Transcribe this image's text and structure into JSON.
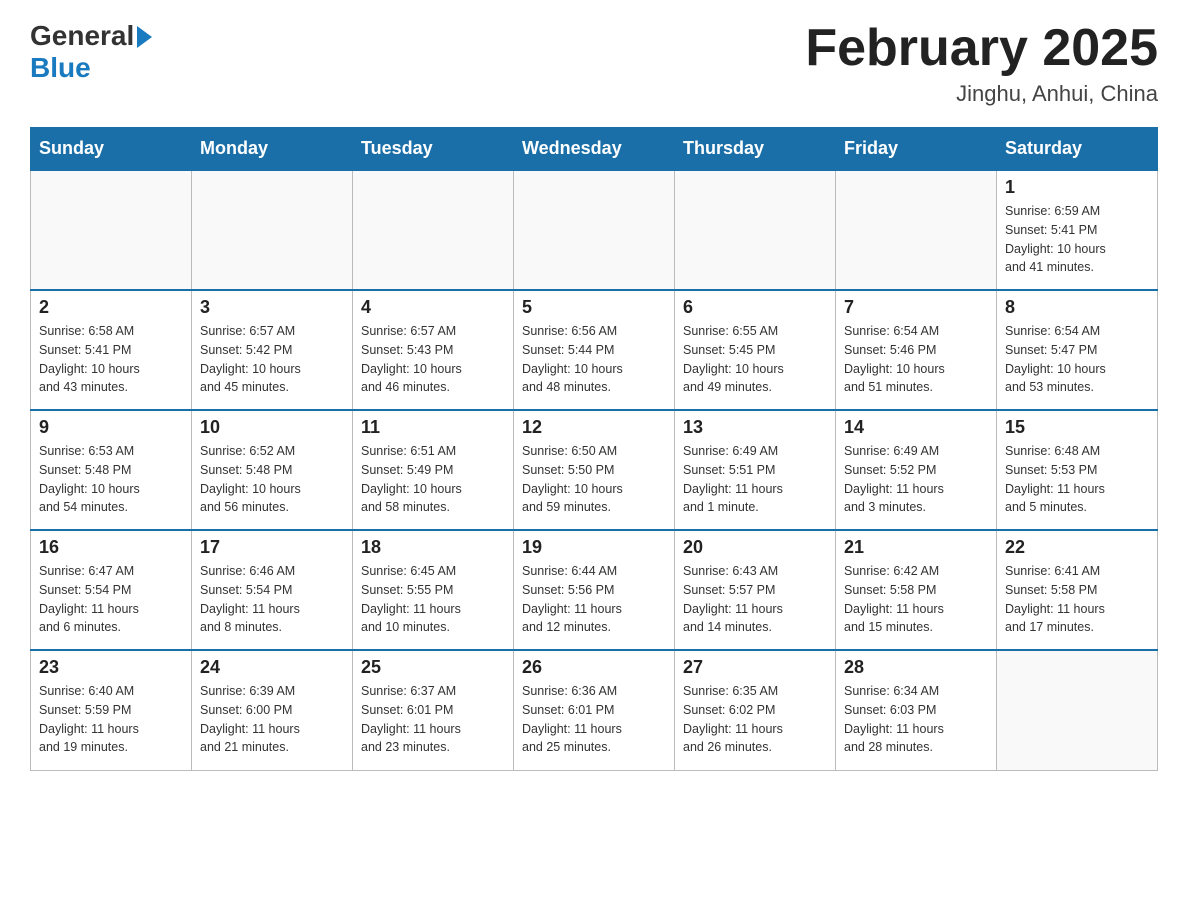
{
  "header": {
    "logo": {
      "general": "General",
      "blue": "Blue",
      "arrow": "▶"
    },
    "title": "February 2025",
    "location": "Jinghu, Anhui, China"
  },
  "weekdays": [
    "Sunday",
    "Monday",
    "Tuesday",
    "Wednesday",
    "Thursday",
    "Friday",
    "Saturday"
  ],
  "weeks": [
    [
      {
        "day": "",
        "info": ""
      },
      {
        "day": "",
        "info": ""
      },
      {
        "day": "",
        "info": ""
      },
      {
        "day": "",
        "info": ""
      },
      {
        "day": "",
        "info": ""
      },
      {
        "day": "",
        "info": ""
      },
      {
        "day": "1",
        "info": "Sunrise: 6:59 AM\nSunset: 5:41 PM\nDaylight: 10 hours\nand 41 minutes."
      }
    ],
    [
      {
        "day": "2",
        "info": "Sunrise: 6:58 AM\nSunset: 5:41 PM\nDaylight: 10 hours\nand 43 minutes."
      },
      {
        "day": "3",
        "info": "Sunrise: 6:57 AM\nSunset: 5:42 PM\nDaylight: 10 hours\nand 45 minutes."
      },
      {
        "day": "4",
        "info": "Sunrise: 6:57 AM\nSunset: 5:43 PM\nDaylight: 10 hours\nand 46 minutes."
      },
      {
        "day": "5",
        "info": "Sunrise: 6:56 AM\nSunset: 5:44 PM\nDaylight: 10 hours\nand 48 minutes."
      },
      {
        "day": "6",
        "info": "Sunrise: 6:55 AM\nSunset: 5:45 PM\nDaylight: 10 hours\nand 49 minutes."
      },
      {
        "day": "7",
        "info": "Sunrise: 6:54 AM\nSunset: 5:46 PM\nDaylight: 10 hours\nand 51 minutes."
      },
      {
        "day": "8",
        "info": "Sunrise: 6:54 AM\nSunset: 5:47 PM\nDaylight: 10 hours\nand 53 minutes."
      }
    ],
    [
      {
        "day": "9",
        "info": "Sunrise: 6:53 AM\nSunset: 5:48 PM\nDaylight: 10 hours\nand 54 minutes."
      },
      {
        "day": "10",
        "info": "Sunrise: 6:52 AM\nSunset: 5:48 PM\nDaylight: 10 hours\nand 56 minutes."
      },
      {
        "day": "11",
        "info": "Sunrise: 6:51 AM\nSunset: 5:49 PM\nDaylight: 10 hours\nand 58 minutes."
      },
      {
        "day": "12",
        "info": "Sunrise: 6:50 AM\nSunset: 5:50 PM\nDaylight: 10 hours\nand 59 minutes."
      },
      {
        "day": "13",
        "info": "Sunrise: 6:49 AM\nSunset: 5:51 PM\nDaylight: 11 hours\nand 1 minute."
      },
      {
        "day": "14",
        "info": "Sunrise: 6:49 AM\nSunset: 5:52 PM\nDaylight: 11 hours\nand 3 minutes."
      },
      {
        "day": "15",
        "info": "Sunrise: 6:48 AM\nSunset: 5:53 PM\nDaylight: 11 hours\nand 5 minutes."
      }
    ],
    [
      {
        "day": "16",
        "info": "Sunrise: 6:47 AM\nSunset: 5:54 PM\nDaylight: 11 hours\nand 6 minutes."
      },
      {
        "day": "17",
        "info": "Sunrise: 6:46 AM\nSunset: 5:54 PM\nDaylight: 11 hours\nand 8 minutes."
      },
      {
        "day": "18",
        "info": "Sunrise: 6:45 AM\nSunset: 5:55 PM\nDaylight: 11 hours\nand 10 minutes."
      },
      {
        "day": "19",
        "info": "Sunrise: 6:44 AM\nSunset: 5:56 PM\nDaylight: 11 hours\nand 12 minutes."
      },
      {
        "day": "20",
        "info": "Sunrise: 6:43 AM\nSunset: 5:57 PM\nDaylight: 11 hours\nand 14 minutes."
      },
      {
        "day": "21",
        "info": "Sunrise: 6:42 AM\nSunset: 5:58 PM\nDaylight: 11 hours\nand 15 minutes."
      },
      {
        "day": "22",
        "info": "Sunrise: 6:41 AM\nSunset: 5:58 PM\nDaylight: 11 hours\nand 17 minutes."
      }
    ],
    [
      {
        "day": "23",
        "info": "Sunrise: 6:40 AM\nSunset: 5:59 PM\nDaylight: 11 hours\nand 19 minutes."
      },
      {
        "day": "24",
        "info": "Sunrise: 6:39 AM\nSunset: 6:00 PM\nDaylight: 11 hours\nand 21 minutes."
      },
      {
        "day": "25",
        "info": "Sunrise: 6:37 AM\nSunset: 6:01 PM\nDaylight: 11 hours\nand 23 minutes."
      },
      {
        "day": "26",
        "info": "Sunrise: 6:36 AM\nSunset: 6:01 PM\nDaylight: 11 hours\nand 25 minutes."
      },
      {
        "day": "27",
        "info": "Sunrise: 6:35 AM\nSunset: 6:02 PM\nDaylight: 11 hours\nand 26 minutes."
      },
      {
        "day": "28",
        "info": "Sunrise: 6:34 AM\nSunset: 6:03 PM\nDaylight: 11 hours\nand 28 minutes."
      },
      {
        "day": "",
        "info": ""
      }
    ]
  ]
}
